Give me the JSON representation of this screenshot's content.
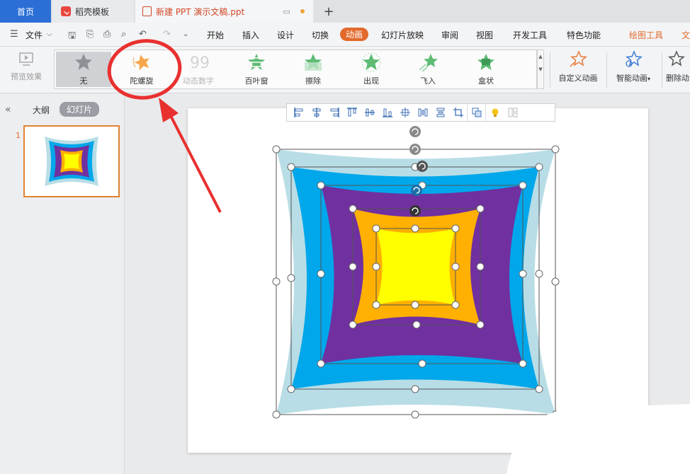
{
  "titlebar": {
    "home_tab": "首页",
    "template_tab": "稻壳模板",
    "doc_tab": "新建 PPT 演示文稿.ppt",
    "new_tab_symbol": "+"
  },
  "menubar": {
    "file_label": "文件",
    "menu_icon": "hamburger-icon",
    "items": [
      "开始",
      "插入",
      "设计",
      "切换",
      "动画",
      "幻灯片放映",
      "审阅",
      "视图",
      "开发工具",
      "特色功能",
      "绘图工具",
      "文"
    ],
    "active_item": "动画",
    "highlight_item": "绘图工具",
    "accent_color": "#e26a2c"
  },
  "ribbon": {
    "preview_label": "预览效果",
    "gallery": [
      {
        "label": "无",
        "icon": "star-gray-icon",
        "selected": true
      },
      {
        "label": "陀螺旋",
        "icon": "star-spin-icon",
        "selected": false
      },
      {
        "label": "动态数字",
        "icon": "number-99-icon",
        "selected": false,
        "disabled": true
      },
      {
        "label": "百叶窗",
        "icon": "star-blinds-icon",
        "selected": false
      },
      {
        "label": "擦除",
        "icon": "star-wipe-icon",
        "selected": false
      },
      {
        "label": "出现",
        "icon": "star-appear-icon",
        "selected": false
      },
      {
        "label": "飞入",
        "icon": "star-fly-icon",
        "selected": false
      },
      {
        "label": "盒状",
        "icon": "star-box-icon",
        "selected": false
      }
    ],
    "custom_anim_label": "自定义动画",
    "smart_anim_label": "智能动画",
    "delete_anim_label": "删除动"
  },
  "leftpanel": {
    "outline_tab": "大纲",
    "slides_tab": "幻灯片",
    "slide_number": "1"
  },
  "colors": {
    "shape_outer": "#b8dde6",
    "shape_blue": "#00a7ea",
    "shape_purple": "#7030a0",
    "shape_orange": "#ffb000",
    "shape_yellow": "#ffff00",
    "annotation_red": "#e8312f"
  }
}
